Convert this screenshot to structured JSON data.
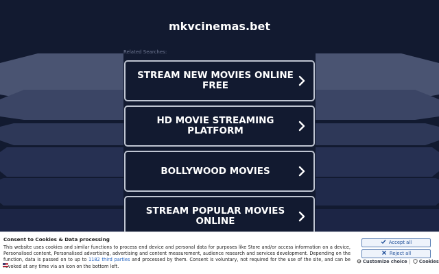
{
  "site": {
    "domain": "mkvcinemas.bet"
  },
  "related": {
    "label": "Related Searches:",
    "items": [
      {
        "label": "STREAM NEW MOVIES ONLINE FREE"
      },
      {
        "label": "HD MOVIE STREAMING PLATFORM"
      },
      {
        "label": "BOLLYWOOD MOVIES"
      },
      {
        "label": "STREAM POPULAR MOVIES ONLINE"
      }
    ]
  },
  "cookie": {
    "title": "Consent to Cookies & Data processing",
    "text_before_link": "This website uses cookies and similar functions to process end device and personal data for purposes like Store and/or access information on a device, Personalised content, Personalised advertising, advertising and content measurement, audience research and services development. Depending on the function, data is passed on to up to ",
    "link": "1182 third parties",
    "text_after_link": " and processed by them. Consent is voluntary, not required for the use of the site, and can be revoked at any time via an icon on the bottom left.",
    "accept_label": "Accept all",
    "reject_label": "Reject all",
    "customize_label": "Customize choice",
    "separator": "|",
    "cookies_label": "Cookies"
  },
  "colors": {
    "background": "#121a30",
    "button_border": "#bfc5d2",
    "accent_link": "#1f5fbf"
  },
  "icons": {
    "chevron": "chevron-right-icon",
    "accept": "check-icon",
    "reject": "close-icon",
    "customize": "gear-icon",
    "cookies": "shield-icon",
    "flag": "flag-icon"
  }
}
